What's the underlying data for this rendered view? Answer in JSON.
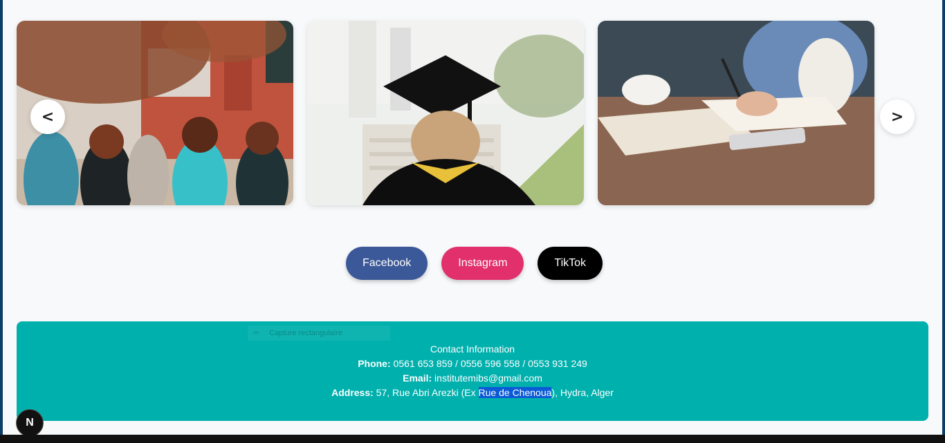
{
  "carousel": {
    "prev_label": "<",
    "next_label": ">",
    "slides": [
      {
        "id": "students",
        "icon": "students-photo"
      },
      {
        "id": "graduate",
        "icon": "graduate-photo"
      },
      {
        "id": "studying",
        "icon": "study-desk-photo"
      }
    ]
  },
  "social": {
    "facebook": {
      "label": "Facebook",
      "color": "#3b5998"
    },
    "instagram": {
      "label": "Instagram",
      "color": "#e1306c"
    },
    "tiktok": {
      "label": "TikTok",
      "color": "#000000"
    }
  },
  "footer": {
    "title": "Contact Information",
    "phone_label": "Phone:",
    "phone_value": " 0561 653 859 / 0556 596 558 / 0553 931 249",
    "email_label": "Email:",
    "email_value": " institutemibs@gmail.com",
    "address_label": "Address:",
    "address_before": " 57, Rue Abri Arezki (Ex ",
    "address_highlight": "Rue de Chenoua",
    "address_after": "), Hydra, Alger",
    "overlay_label": "Capture rectangulaire",
    "background": "#00b0ad"
  },
  "badge": {
    "label": "N"
  }
}
